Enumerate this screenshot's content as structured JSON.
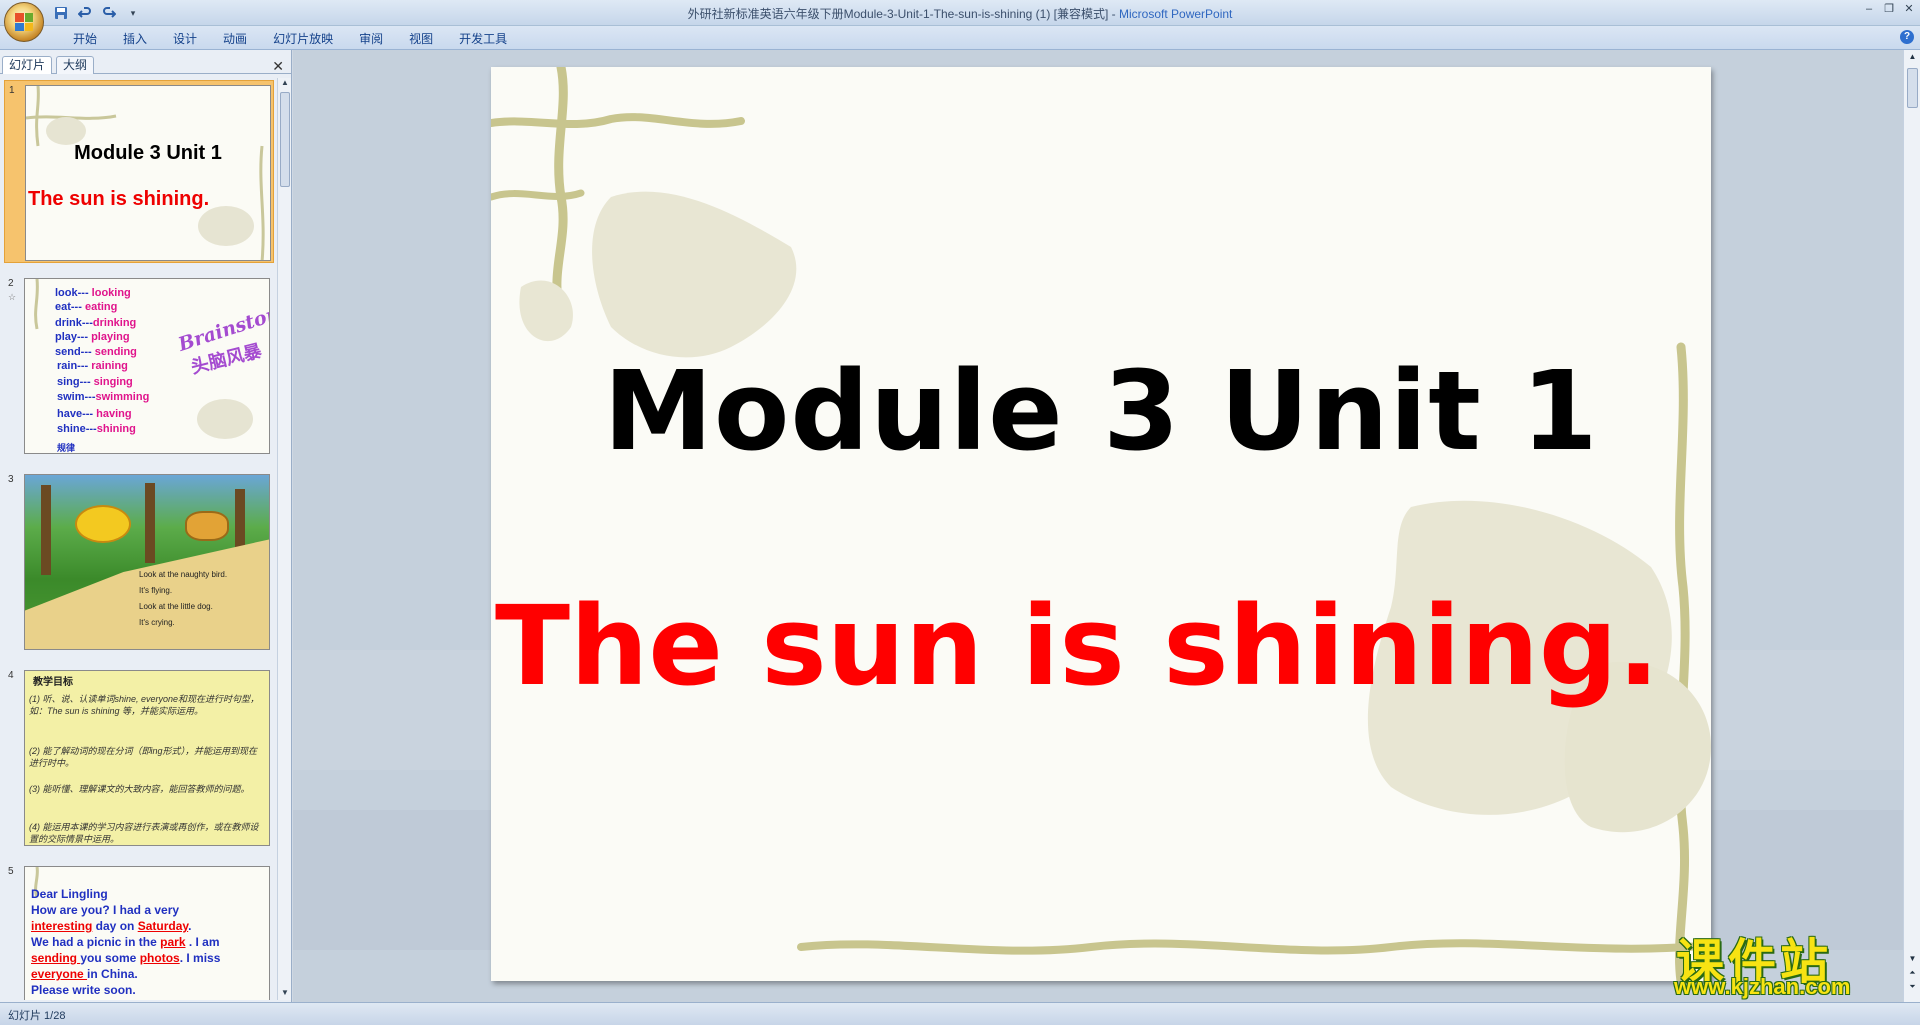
{
  "window": {
    "title": "外研社新标准英语六年级下册Module-3-Unit-1-The-sun-is-shining (1) [兼容模式]",
    "separator": " - ",
    "app_name": "Microsoft PowerPoint",
    "controls": [
      "minimize-icon",
      "restore-icon",
      "close-icon"
    ]
  },
  "quick_access": [
    "save-icon",
    "undo-icon",
    "redo-icon",
    "customize-icon"
  ],
  "ribbon": {
    "tabs": [
      "开始",
      "插入",
      "设计",
      "动画",
      "幻灯片放映",
      "审阅",
      "视图",
      "开发工具"
    ],
    "help_label": "?"
  },
  "left_panel": {
    "tabs": [
      "幻灯片",
      "大纲"
    ],
    "close_label": "✕",
    "thumbnails": [
      {
        "number": "1",
        "title": "Module 3 Unit 1",
        "subtitle": "The sun is shining."
      },
      {
        "number": "2",
        "pairs": [
          {
            "base": "look---",
            "ing": "looking"
          },
          {
            "base": "eat---",
            "ing": "eating"
          },
          {
            "base": "drink---",
            "ing": "drinking"
          },
          {
            "base": "play---",
            "ing": "playing"
          },
          {
            "base": "send---",
            "ing": "sending"
          },
          {
            "base": "rain---",
            "ing": "raining"
          },
          {
            "base": "sing---",
            "ing": "singing"
          },
          {
            "base": "swim---",
            "ing": "swimming"
          },
          {
            "base": "have---",
            "ing": "having"
          },
          {
            "base": "shine---",
            "ing": "shining"
          }
        ],
        "footer": "规律",
        "brainstorm": "Brainstorming!",
        "brainstorm_cn": "头脑风暴"
      },
      {
        "number": "3",
        "lines": [
          "Look at the naughty bird.",
          "It's flying.",
          "Look at the little dog.",
          "It's crying."
        ]
      },
      {
        "number": "4",
        "heading": "教学目标",
        "items": [
          "(1) 听、说、认读单词shine, everyone和现在进行时句型，如：The sun is shining 等，并能实际运用。",
          "(2) 能了解动词的现在分词（即ing形式），并能运用到现在进行时中。",
          "(3) 能听懂、理解课文的大致内容，能回答教师的问题。",
          "(4) 能运用本课的学习内容进行表演或再创作，或在教师设置的交际情景中运用。"
        ]
      },
      {
        "number": "5",
        "salutation": "Dear  Lingling",
        "line1": "How are you? I had a very",
        "w_interesting": "interesting",
        "w_dayon": " day on ",
        "w_saturday": "Saturday",
        "w_dot": ".",
        "w_picnic": " We had a picnic in the ",
        "w_park": "park",
        "w_iam": " . I am",
        "w_sending": "sending ",
        "w_yousome": "you some  ",
        "w_photos": "photos",
        "w_miss": ". I miss",
        "w_everyone": "everyone ",
        "w_china": " in China.",
        "w_last": "Please write soon."
      }
    ]
  },
  "slide": {
    "title": "Module 3 Unit 1",
    "subtitle": "The sun is shining."
  },
  "status": {
    "slide_indicator": "幻灯片 1/28"
  },
  "watermark": {
    "cn": "课件站",
    "url": "www.kjzhan.com"
  },
  "colors": {
    "title_red": "#ff0000",
    "selected_thumb": "#f6c36d",
    "ribbon_text": "#15428b"
  }
}
